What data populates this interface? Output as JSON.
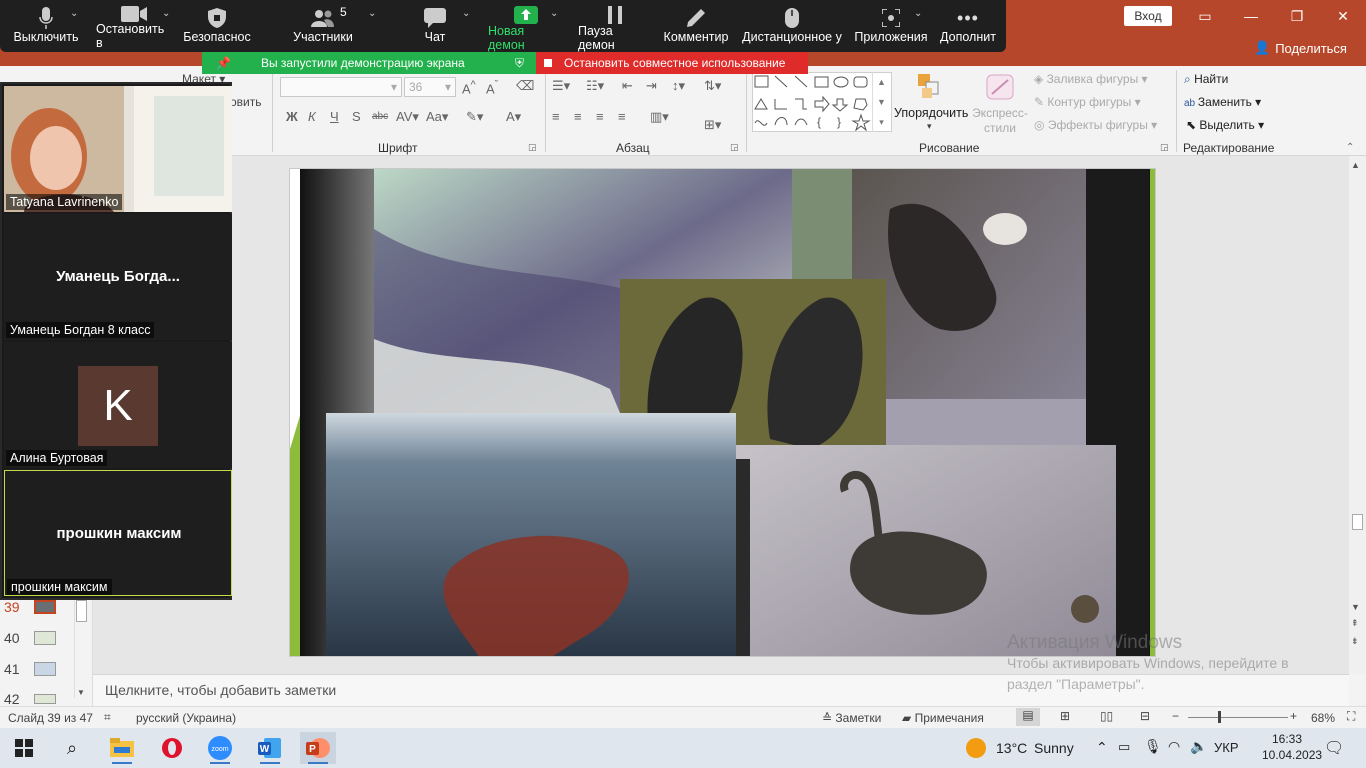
{
  "window": {
    "signin": "Вход",
    "share": "Поделиться"
  },
  "zoom_toolbar": {
    "mute": "Выключить",
    "stop_video": "Остановить в",
    "security": "Безопаснос",
    "participants": "Участники",
    "participants_count": "5",
    "chat": "Чат",
    "new_share": "Новая демон",
    "pause_share": "Пауза демон",
    "annotate": "Комментир",
    "remote_control": "Дистанционное у",
    "apps": "Приложения",
    "more": "Дополнит"
  },
  "share_banner": "Вы запустили демонстрацию экрана",
  "stop_banner": "Остановить совместное использование",
  "participants": [
    {
      "name": "Tatyana Lavrinenko",
      "center": "",
      "has_video": true
    },
    {
      "name": "Уманець Богдан 8 класс",
      "center": "Уманець  Богда..."
    },
    {
      "name": "Алина Буртовая",
      "center": "",
      "avatar": "K",
      "avatar_color": "#5a3a30"
    },
    {
      "name": "прошкин максим",
      "center": "прошкин максим"
    }
  ],
  "ribbon": {
    "groups": {
      "font": "Шрифт",
      "paragraph": "Абзац",
      "drawing": "Рисование",
      "editing": "Редактирование"
    },
    "partial_left": {
      "layout": "Макет",
      "restore": "овить"
    },
    "font_size": "36",
    "arrange": "Упорядочить",
    "quick_styles": "Экспресс-\nстили",
    "shape_fill": "Заливка фигуры",
    "shape_outline": "Контур фигуры",
    "shape_effects": "Эффекты фигуры",
    "find": "Найти",
    "replace": "Заменить",
    "select": "Выделить"
  },
  "thumbnails": [
    {
      "num": "39",
      "active": true
    },
    {
      "num": "40"
    },
    {
      "num": "41"
    },
    {
      "num": "42"
    }
  ],
  "notes_placeholder": "Щелкните, чтобы добавить заметки",
  "activation": {
    "title": "Активация Windows",
    "line1": "Чтобы активировать Windows, перейдите в",
    "line2": "раздел \"Параметры\"."
  },
  "status": {
    "slide": "Слайд 39 из 47",
    "language": "русский (Украина)",
    "notes": "Заметки",
    "comments": "Примечания",
    "zoom": "68%"
  },
  "taskbar": {
    "weather_temp": "13°C",
    "weather_desc": "Sunny",
    "lang": "УКР",
    "time": "16:33",
    "date": "10.04.2023"
  },
  "colors": {
    "ppt_red": "#b7472a",
    "zoom_green": "#22b14c",
    "zoom_red": "#e02b2b"
  }
}
